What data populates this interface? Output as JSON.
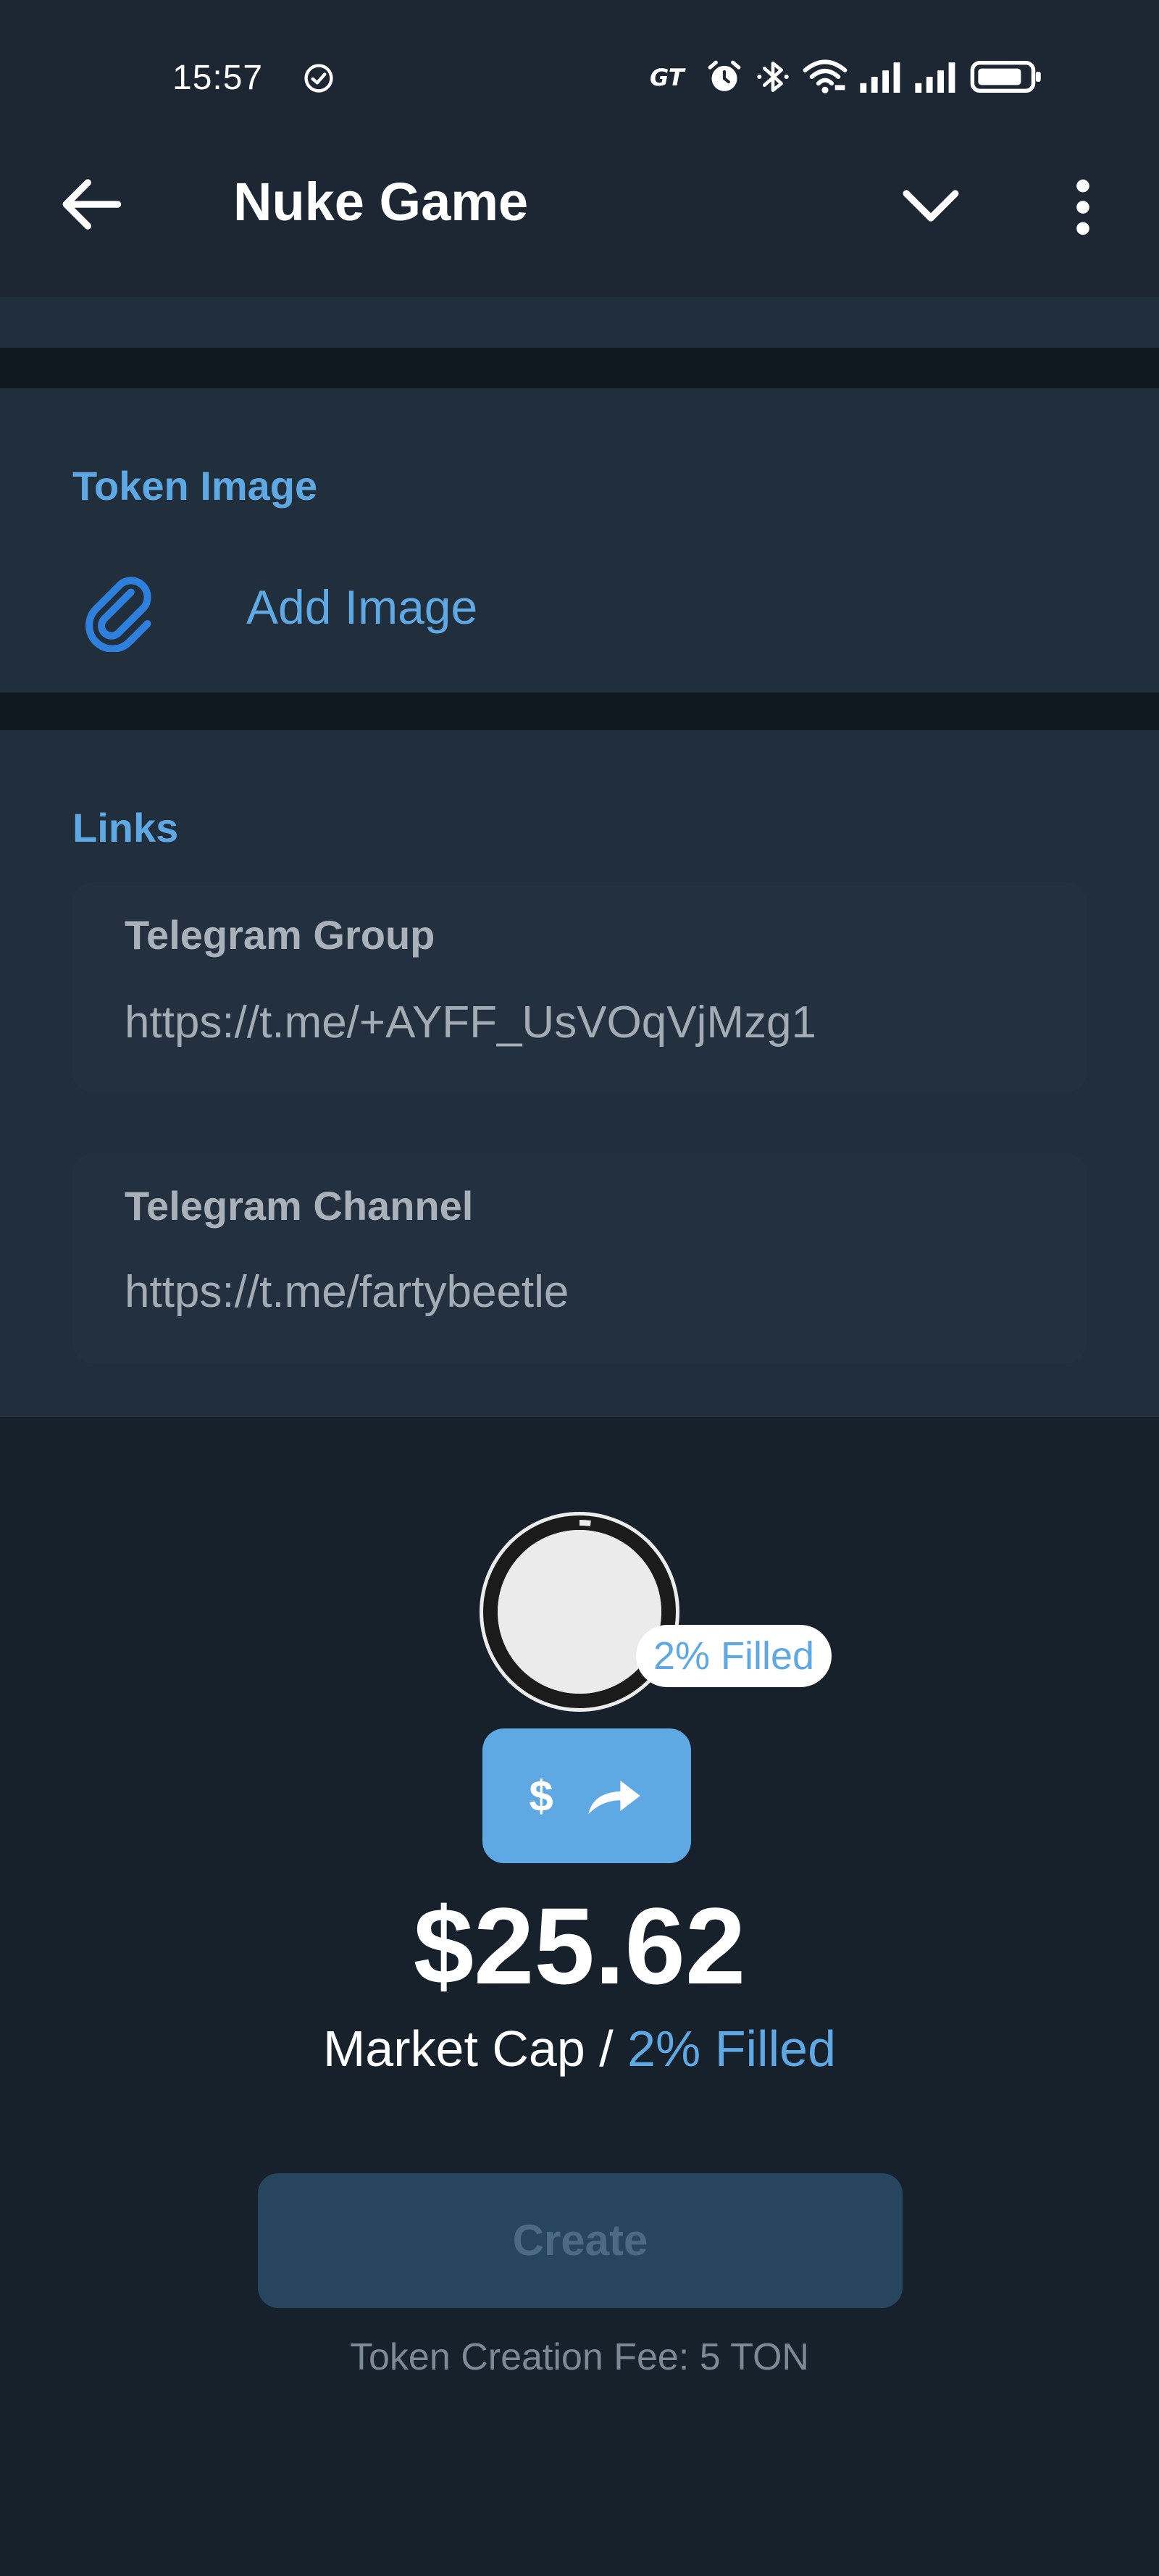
{
  "status_bar": {
    "time": "15:57"
  },
  "header": {
    "title": "Nuke Game"
  },
  "token_image": {
    "section_title": "Token Image",
    "add_image_label": "Add Image"
  },
  "links": {
    "section_title": "Links",
    "telegram_group": {
      "label": "Telegram Group",
      "value": "https://t.me/+AYFF_UsVOqVjMzg1"
    },
    "telegram_channel": {
      "label": "Telegram Channel",
      "value": "https://t.me/fartybeetle"
    }
  },
  "progress": {
    "badge_text": "2% Filled",
    "fill_fraction": 0.02
  },
  "swap_button": {
    "symbol": "$"
  },
  "market_cap": {
    "value": "$25.62",
    "label": "Market Cap /",
    "filled_text": "2% Filled"
  },
  "create_button": {
    "label": "Create"
  },
  "fee_text": "Token Creation Fee: 5 TON",
  "colors": {
    "accent": "#5ea8e3",
    "background": "#17212b",
    "section_background": "#212e3b",
    "create_disabled": "#27455f"
  }
}
